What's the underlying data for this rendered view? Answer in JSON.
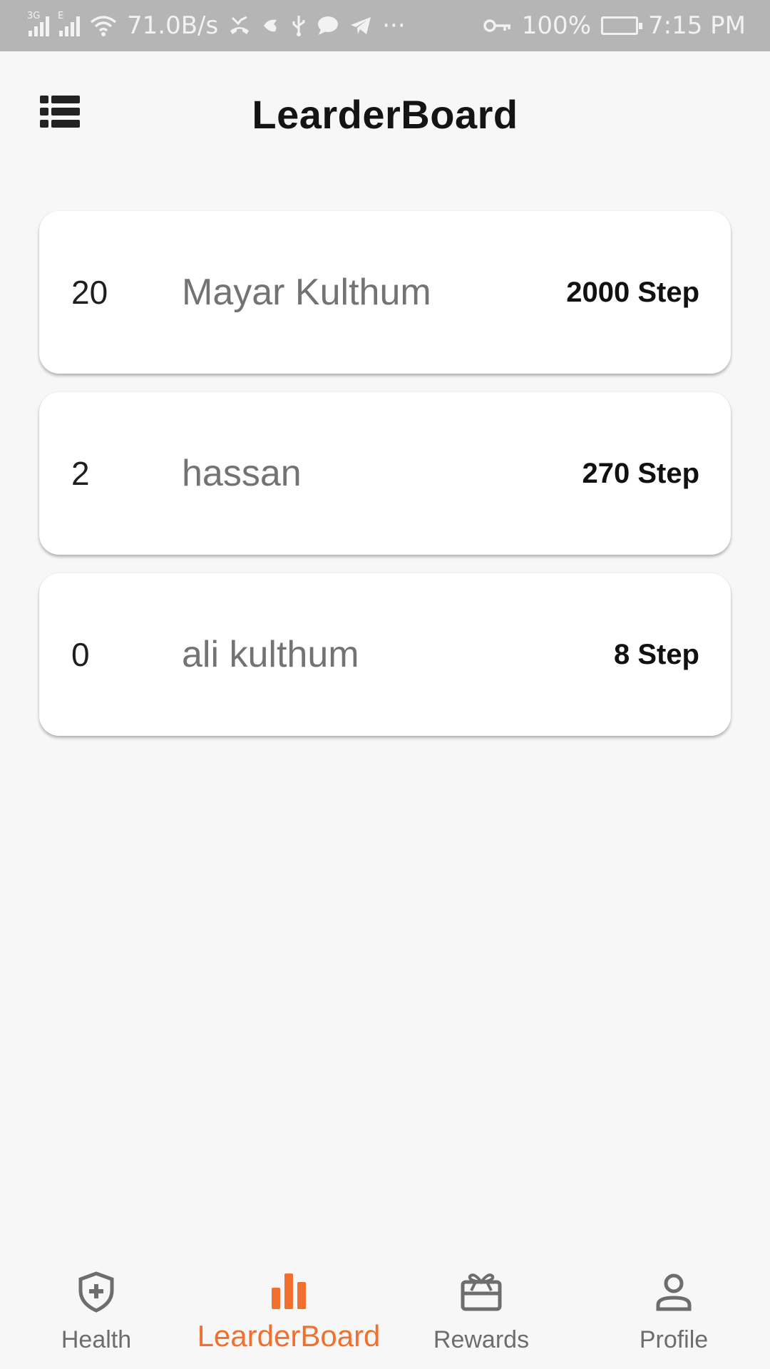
{
  "status_bar": {
    "net_speed": "71.0B/s",
    "signal_1_tag": "3G",
    "signal_2_tag": "E",
    "more": "···",
    "battery": "100%",
    "time": "7:15 PM"
  },
  "header": {
    "title": "LearderBoard"
  },
  "leaderboard": [
    {
      "rank": "20",
      "name": "Mayar Kulthum",
      "steps": "2000 Step"
    },
    {
      "rank": "2",
      "name": "hassan",
      "steps": "270 Step"
    },
    {
      "rank": "0",
      "name": "ali kulthum",
      "steps": "8 Step"
    }
  ],
  "nav": [
    {
      "label": "Health",
      "icon": "shield-plus-icon"
    },
    {
      "label": "LearderBoard",
      "icon": "bar-chart-icon",
      "active": true
    },
    {
      "label": "Rewards",
      "icon": "gift-icon"
    },
    {
      "label": "Profile",
      "icon": "person-icon"
    }
  ],
  "colors": {
    "accent": "#f07030",
    "inactive": "#6d6d6d",
    "status_bar": "#b5b5b5"
  }
}
